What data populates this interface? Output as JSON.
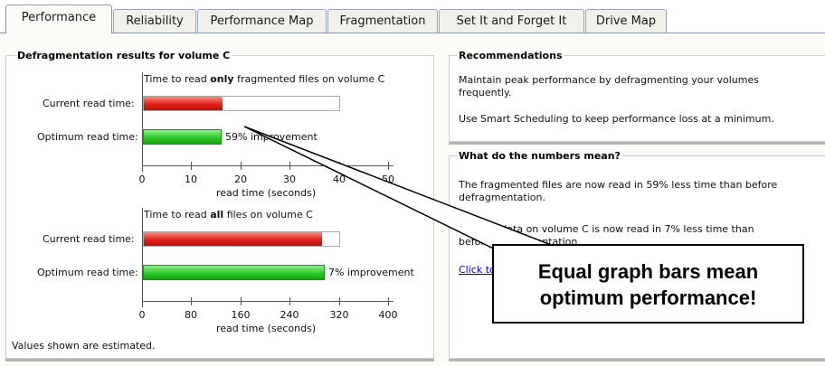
{
  "tabs": [
    {
      "label": "Performance",
      "active": true
    },
    {
      "label": "Reliability",
      "active": false
    },
    {
      "label": "Performance Map",
      "active": false
    },
    {
      "label": "Fragmentation",
      "active": false
    },
    {
      "label": "Set It and Forget It",
      "active": false
    },
    {
      "label": "Drive Map",
      "active": false
    }
  ],
  "results": {
    "title": "Defragmentation results for volume C",
    "chart1": {
      "caption_pre": "Time to read ",
      "caption_bold": "only",
      "caption_post": " fragmented files on volume C",
      "current_label": "Current read time:",
      "optimum_label": "Optimum read time:",
      "improvement": "59% improvement",
      "ticks": [
        "0",
        "10",
        "20",
        "30",
        "40",
        "50"
      ],
      "xlabel": "read time (seconds)"
    },
    "chart2": {
      "caption_pre": "Time to read ",
      "caption_bold": "all",
      "caption_post": " files on volume C",
      "current_label": "Current read time:",
      "optimum_label": "Optimum read time:",
      "improvement": "7% improvement",
      "ticks": [
        "0",
        "80",
        "160",
        "240",
        "320",
        "400"
      ],
      "xlabel": "read time (seconds)"
    },
    "footnote": "Values shown are estimated."
  },
  "chart_data": [
    {
      "type": "bar",
      "categories": [
        "Current read time:",
        "Optimum read time:"
      ],
      "values": [
        16,
        16
      ],
      "scale_max": 40,
      "xlabel": "read time (seconds)",
      "xlim": [
        0,
        50
      ],
      "ticks": [
        0,
        10,
        20,
        30,
        40,
        50
      ],
      "annotation": "59% improvement"
    },
    {
      "type": "bar",
      "categories": [
        "Current read time:",
        "Optimum read time:"
      ],
      "values": [
        290,
        295
      ],
      "scale_max": 320,
      "xlabel": "read time (seconds)",
      "xlim": [
        0,
        400
      ],
      "ticks": [
        0,
        80,
        160,
        240,
        320,
        400
      ],
      "annotation": "7% improvement"
    }
  ],
  "recommendations": {
    "title": "Recommendations",
    "line1": "Maintain peak performance by defragmenting your volumes frequently.",
    "line2": "Use Smart Scheduling to keep performance loss at a minimum."
  },
  "numbers": {
    "title": "What do the numbers mean?",
    "line1": "The fragmented files are now read in 59% less time than before defragmentation.",
    "line2": "Overall, data on volume C is now read in 7% less time than before defragmentation.",
    "link": "Click to learn more"
  },
  "callout": {
    "line1": "Equal graph bars mean",
    "line2": "optimum performance!"
  },
  "colors": {
    "current_bar": "#e0221b",
    "optimum_bar": "#2fcb2a",
    "link": "#0000cc"
  }
}
